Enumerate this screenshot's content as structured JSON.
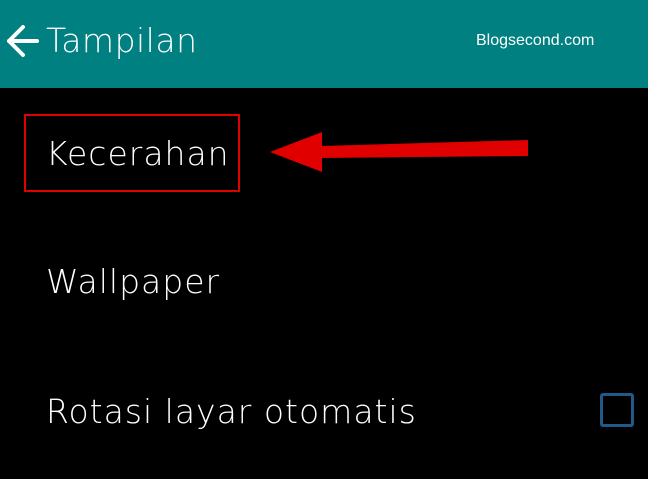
{
  "header": {
    "title": "Tampilan",
    "back_icon": "arrow-left-icon",
    "background_color": "#008080"
  },
  "watermark": {
    "text": "Blogsecond.com"
  },
  "settings": {
    "items": [
      {
        "label": "Kecerahan"
      },
      {
        "label": "Wallpaper"
      },
      {
        "label": "Rotasi layar otomatis",
        "checkbox_checked": false
      }
    ]
  },
  "annotations": {
    "highlight_color": "#e00000",
    "arrow_icon": "red-arrow-left-icon"
  }
}
